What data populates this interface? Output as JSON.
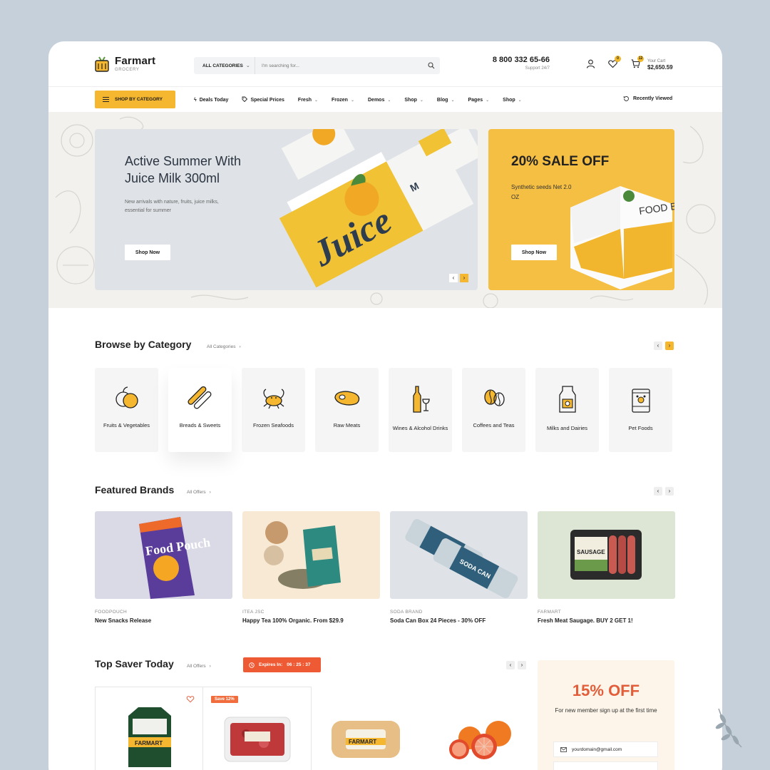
{
  "header": {
    "logo_name": "Farmart",
    "logo_sub": "GROCERY",
    "search_category": "ALL CATEGORIES",
    "search_placeholder": "I'm searching for...",
    "phone": "8 800 332 65-66",
    "phone_sub": "Support 24/7",
    "wishlist_count": "0",
    "cart_count": "12",
    "cart_label": "Your Cart",
    "cart_amount": "$2,650.59"
  },
  "nav": {
    "shop_by": "SHOP BY CATEGORY",
    "items": [
      "Deals Today",
      "Special Prices",
      "Fresh",
      "Frozen",
      "Demos",
      "Shop",
      "Blog",
      "Pages",
      "Shop"
    ],
    "recent": "Recently Viewed"
  },
  "hero": {
    "banner1_title": "Active Summer With Juice Milk 300ml",
    "banner1_text": "New arrivals with nature, fruits, juice milks, essential for summer",
    "banner1_btn": "Shop Now",
    "banner1_pack_label": "MOCKUP",
    "banner1_pack_word": "Juice",
    "banner2_title": "20% SALE OFF",
    "banner2_text": "Synthetic seeds Net 2.0 OZ",
    "banner2_btn": "Shop Now",
    "banner2_box_text": "FOOD BOX Mockup"
  },
  "categories": {
    "title": "Browse by Category",
    "link": "All Categories",
    "items": [
      {
        "label": "Fruits & Vegetables",
        "icon": "fruit-icon"
      },
      {
        "label": "Breads & Sweets",
        "icon": "bread-icon"
      },
      {
        "label": "Frozen Seafoods",
        "icon": "crab-icon"
      },
      {
        "label": "Raw Meats",
        "icon": "steak-icon"
      },
      {
        "label": "Wines & Alcohol Drinks",
        "icon": "wine-icon"
      },
      {
        "label": "Coffees and Teas",
        "icon": "coffee-beans-icon"
      },
      {
        "label": "Milks and Dairies",
        "icon": "milk-carton-icon"
      },
      {
        "label": "Pet Foods",
        "icon": "pet-food-icon"
      }
    ]
  },
  "brands": {
    "title": "Featured Brands",
    "link": "All Offers",
    "items": [
      {
        "brand": "FOODPOUCH",
        "desc": "New Snacks Release",
        "bg": "#d9dae5",
        "image_text": "Food Pouch"
      },
      {
        "brand": "ITEA JSC",
        "desc": "Happy Tea 100% Organic. From $29.9",
        "bg": "#f7e9d4"
      },
      {
        "brand": "SODA BRAND",
        "desc": "Soda Can Box 24 Pieces - 30% OFF",
        "bg": "#dfe3e8",
        "image_text": "SODA CAN"
      },
      {
        "brand": "FARMART",
        "desc": "Fresh Meat Saugage. BUY 2 GET 1!",
        "bg": "#dde5d5",
        "image_text": "SAUSAGE"
      }
    ]
  },
  "saver": {
    "title": "Top Saver Today",
    "link": "All Offers",
    "expires_label": "Expires In:",
    "countdown": "06 : 25 : 37",
    "save_badge": "Save 12%",
    "product_labels": [
      "FARMART",
      "FARMART"
    ],
    "promo_title": "15% OFF",
    "promo_text": "For new member sign up at the first time",
    "email_value": "yourdomain@gmail.com"
  },
  "colors": {
    "accent": "#f5b730",
    "orange": "#ee5a33",
    "promo": "#e25d3a"
  }
}
